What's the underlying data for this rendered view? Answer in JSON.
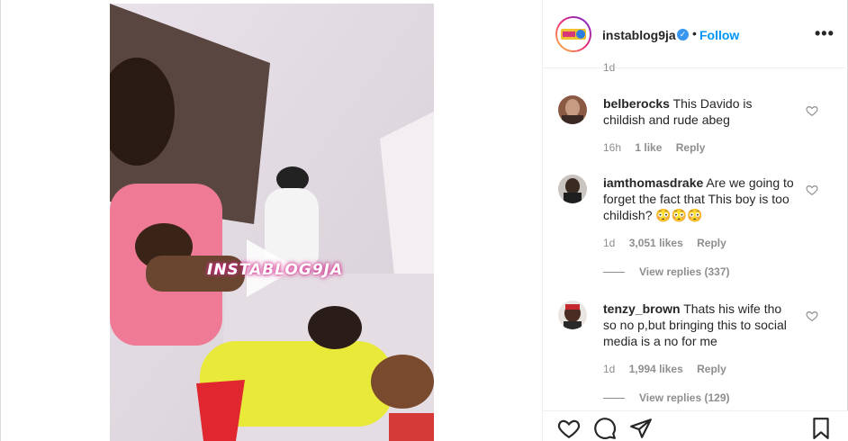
{
  "post": {
    "username": "instablog9ja",
    "verified_mark": "✓",
    "separator": "•",
    "follow_label": "Follow",
    "more_label": "•••",
    "watermark": "INSTABLOG9JA",
    "avatar_text": "INSTABLOG9JA"
  },
  "partial_timestamp": "1d",
  "comments": [
    {
      "user": "belberocks",
      "text": "This Davido is childish and rude abeg",
      "time": "16h",
      "likes": "1 like",
      "reply": "Reply"
    },
    {
      "user": "iamthomasdrake",
      "text": "Are we going to forget the fact that This boy is too childish? 😳😳😳",
      "time": "1d",
      "likes": "3,051 likes",
      "reply": "Reply",
      "view_replies": "View replies (337)"
    },
    {
      "user": "tenzy_brown",
      "text": "Thats his wife tho so no p,but bringing this to social media is a no for me",
      "time": "1d",
      "likes": "1,994 likes",
      "reply": "Reply",
      "view_replies": "View replies (129)"
    }
  ],
  "icons": {
    "like": "heart-icon",
    "comment": "comment-icon",
    "share": "paper-plane-icon",
    "save": "bookmark-icon",
    "play": "play-icon",
    "verified": "verified-badge-icon",
    "comment_like": "heart-outline-icon"
  },
  "colors": {
    "link_blue": "#0095f6",
    "verified_blue": "#3897f0",
    "muted": "#8e8e8e",
    "text": "#262626"
  }
}
